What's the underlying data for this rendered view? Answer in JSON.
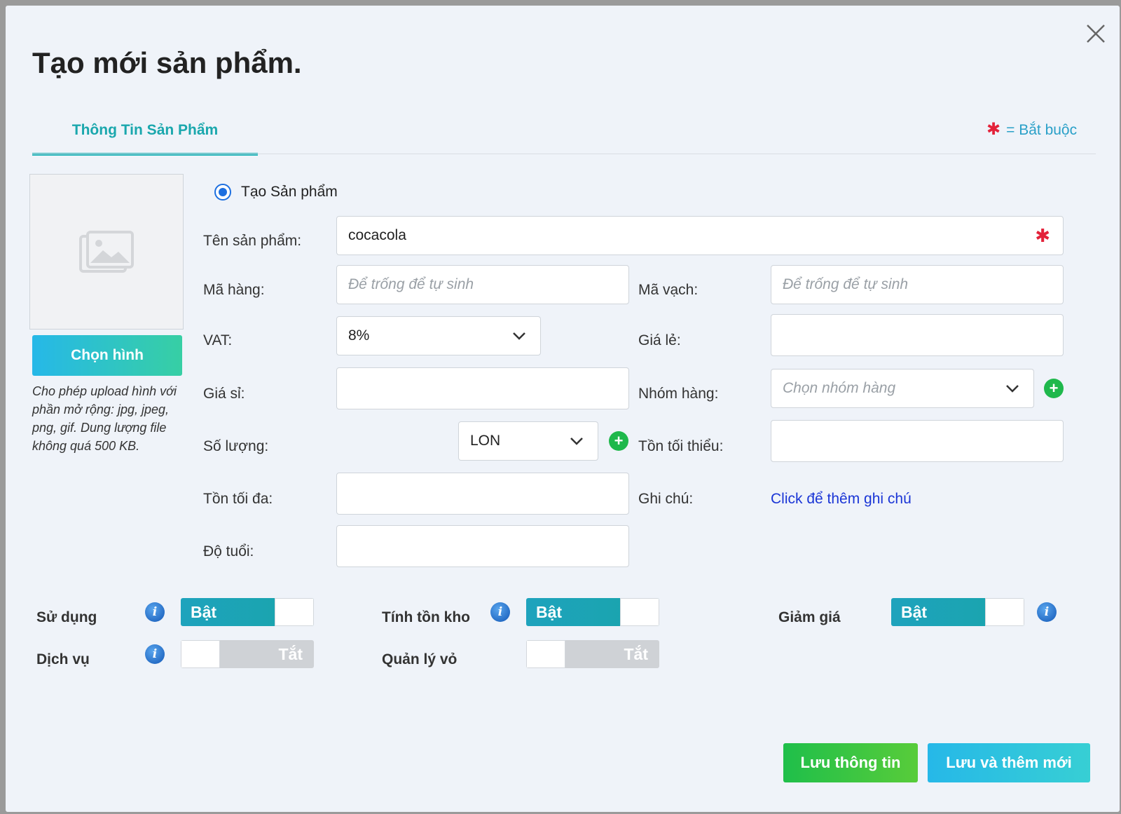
{
  "modal": {
    "title": "Tạo mới sản phẩm.",
    "tab_label": "Thông Tin Sản Phẩm",
    "required_note": "= Bắt buộc",
    "required_star": "✱"
  },
  "image": {
    "choose_label": "Chọn hình",
    "upload_note": "Cho phép upload hình với phần mở rộng: jpg, jpeg, png, gif. Dung lượng file không quá 500 KB."
  },
  "form": {
    "radio_label": "Tạo Sản phẩm",
    "product_name": {
      "label": "Tên sản phẩm:",
      "value": "cocacola"
    },
    "sku": {
      "label": "Mã hàng:",
      "placeholder": "Để trống để tự sinh"
    },
    "barcode": {
      "label": "Mã vạch:",
      "placeholder": "Để trống để tự sinh"
    },
    "vat": {
      "label": "VAT:",
      "value": "8%"
    },
    "retail_price": {
      "label": "Giá lẻ:",
      "value": ""
    },
    "wholesale_price": {
      "label": "Giá sỉ:",
      "value": ""
    },
    "group": {
      "label": "Nhóm hàng:",
      "placeholder": "Chọn nhóm hàng"
    },
    "quantity": {
      "label": "Số lượng:",
      "unit": "LON"
    },
    "min_stock": {
      "label": "Tồn tối thiểu:",
      "value": ""
    },
    "max_stock": {
      "label": "Tồn tối đa:",
      "value": ""
    },
    "note": {
      "label": "Ghi chú:",
      "link": "Click để thêm ghi chú"
    },
    "age": {
      "label": "Độ tuổi:",
      "value": ""
    }
  },
  "toggles": {
    "use": {
      "label": "Sử dụng",
      "state": "Bật"
    },
    "inventory": {
      "label": "Tính tồn kho",
      "state": "Bật"
    },
    "discount": {
      "label": "Giảm giá",
      "state": "Bật"
    },
    "service": {
      "label": "Dịch vụ",
      "state": "Tắt"
    },
    "shell_mgmt": {
      "label": "Quản lý vỏ",
      "state": "Tắt"
    },
    "info_glyph": "i"
  },
  "buttons": {
    "save": "Lưu thông tin",
    "save_new": "Lưu và thêm mới",
    "plus": "+"
  },
  "colors": {
    "accent": "#1aa7ad",
    "required": "#e3223a",
    "save": "#1fbf4a",
    "save_new": "#26b8e8",
    "link": "#1a35d6"
  }
}
